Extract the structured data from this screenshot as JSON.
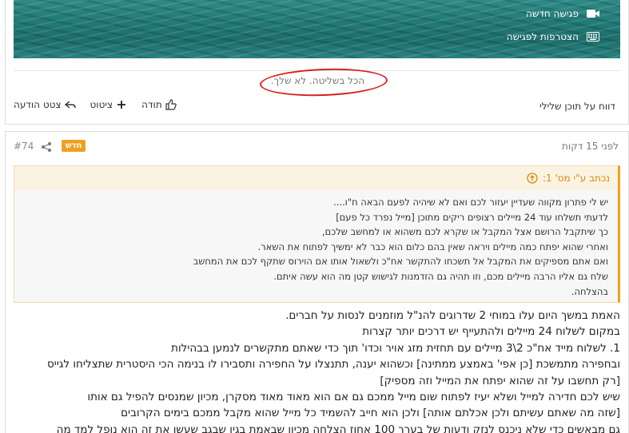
{
  "banner": {
    "links": [
      {
        "label": "פגישה חדשה",
        "icon": "video-camera-icon"
      },
      {
        "label": "הצטרפות לפגישה",
        "icon": "keyboard-icon"
      }
    ]
  },
  "previous_post": {
    "signature": "הכל בשליטה. לא שלך.",
    "actions": {
      "thanks_label": "תודה",
      "quote_label": "ציטוט",
      "quote_message_label": "צטט הודעה"
    },
    "report_label": "דווח על תוכן שלילי"
  },
  "post": {
    "number": "#74",
    "badge": "חדש",
    "time": "לפני 15 דקות",
    "quote": {
      "header": "נכתב ע\"י מס' 1:",
      "lines": [
        "יש לי פתרון מקווה שעדיין יעזור לכם ואם לא שיהיה לפעם הבאה ח\"ו....",
        "לדעתי תשלחו עוד 24 מיילים רצופים ריקים מתוכן [מייל נפרד כל פעם]",
        "כך שיתקבל הרושם אצל המקבל או שקרא לכם משהוא או למחשב שלכם,",
        "ואחרי שהוא יפתח כמה מיילים ויראה שאין בהם כלום הוא כבר לא ימשיך לפתוח את השאר.",
        "ואם אתם מספיקים את המקבל אל תשכחו להתקשר אח\"כ ולשאול אותו אם הוירוס שתקף לכם את המחשב",
        "שלח גם אליו הרבה מיילים מכם, וזו תהיה גם הזדמנות לגישוש קטן מה הוא עשה איתם.",
        "בהצלחה."
      ]
    },
    "body_lines": [
      "האמת במשך היום עלו במוחי 2 שדרוגים להנ\"ל מוזמנים לנסות על חברים.",
      "במקום לשלוח 24 מיילים ולהתעייף יש דרכים יותר קצרות",
      "1. לשלוח מייד אח\"כ 2\\3 מיילים עם תחזית מזג אויר וכדו' תוך כדי שאתם מתקשרים לנמען בבהילות",
      "ובחפירה מתמשכת [כן אפי' באמצע ממתינה] וכשהוא יענה, תתנצלו על החפירה ותסבירו לו בנימה הכי היסטרית שתצליחו לגייס",
      "[רק תחשבו על זה שהוא יפתח את המייל וזה מספיק]",
      "שיש לכם חדירה למייל ושלא יעיז לפתוח שום מייל ממכם גם אם הוא מאוד מאוד מסקרן, מכיון שמנסים להפיל גם אותו",
      "[שזה מה שאתם עשיתם ולכן אכלתם אותה] ולכן הוא חייב להשמיד כל מייל שהוא מקבל ממכם בימים הקרובים",
      "גם מבאשים כדי שלא ניכנס לנזק ודעות של בערך 100 אחוז הצלחה מכיון שבאמת בגין שבגב שעשו את זה הוא נופל למד מה"
    ]
  }
}
